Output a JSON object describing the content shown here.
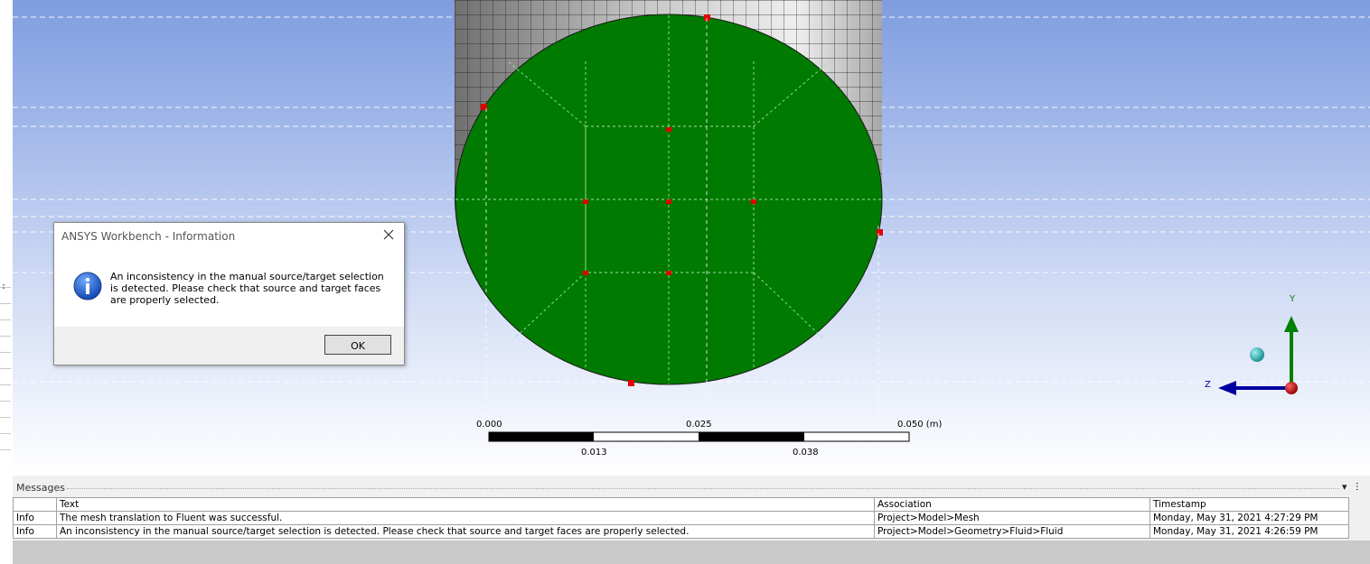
{
  "viewport": {
    "scale_bar": {
      "top_labels": [
        "0.000",
        "0.025",
        "0.050 (m)"
      ],
      "bottom_labels": [
        "0.013",
        "0.038"
      ]
    },
    "triad": {
      "y_label": "Y",
      "z_label": "Z"
    },
    "colors": {
      "face": "#007a00",
      "triad_y": "#008000",
      "triad_z": "#0000a0",
      "origin": "#cc0000",
      "iso_ball": "#1fb5b5"
    }
  },
  "dialog": {
    "title": "ANSYS Workbench - Information",
    "icon": "info-icon",
    "message": "An inconsistency in the manual source/target selection is detected. Please check that source and target faces are properly selected.",
    "ok_label": "OK"
  },
  "messages": {
    "title": "Messages",
    "columns": [
      "Text",
      "Association",
      "Timestamp"
    ],
    "rows": [
      {
        "type": "Info",
        "text": "The mesh translation to Fluent was successful.",
        "association": "Project>Model>Mesh",
        "timestamp": "Monday, May 31, 2021 4:27:29 PM"
      },
      {
        "type": "Info",
        "text": "An inconsistency in the manual source/target selection is detected. Please check that source and target faces are properly selected.",
        "association": "Project>Model>Geometry>Fluid>Fluid",
        "timestamp": "Monday, May 31, 2021 4:26:59 PM"
      }
    ],
    "controls": {
      "menu_icon": "dropdown-icon",
      "pin_icon": "pin-icon"
    }
  }
}
